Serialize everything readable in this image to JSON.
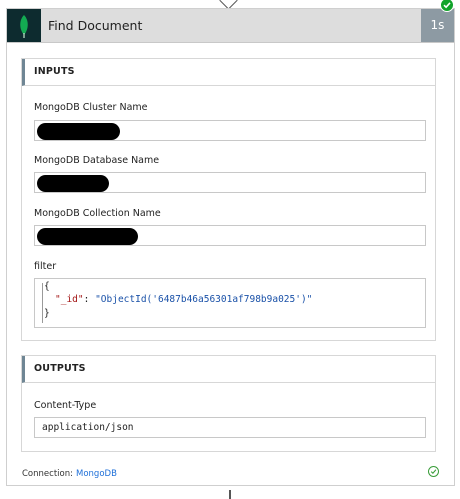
{
  "action": {
    "title": "Find Document",
    "duration": "1s",
    "logo_icon": "mongodb-leaf-icon",
    "status_icon": "success-check-icon",
    "accent_color": "#13aa52",
    "success_color": "#12a32b"
  },
  "inputs": {
    "heading": "INPUTS",
    "cluster_label": "MongoDB Cluster Name",
    "database_label": "MongoDB Database Name",
    "collection_label": "MongoDB Collection Name",
    "filter_label": "filter",
    "filter_open": "{",
    "filter_key": "\"_id\"",
    "filter_colon": ": ",
    "filter_value": "\"ObjectId('6487b46a56301af798b9a025')\"",
    "filter_close": "}"
  },
  "outputs": {
    "heading": "OUTPUTS",
    "content_type_label": "Content-Type",
    "content_type_value": "application/json"
  },
  "footer": {
    "connection_label": "Connection:",
    "connection_link": "MongoDB",
    "check_icon": "connection-ok-icon"
  }
}
